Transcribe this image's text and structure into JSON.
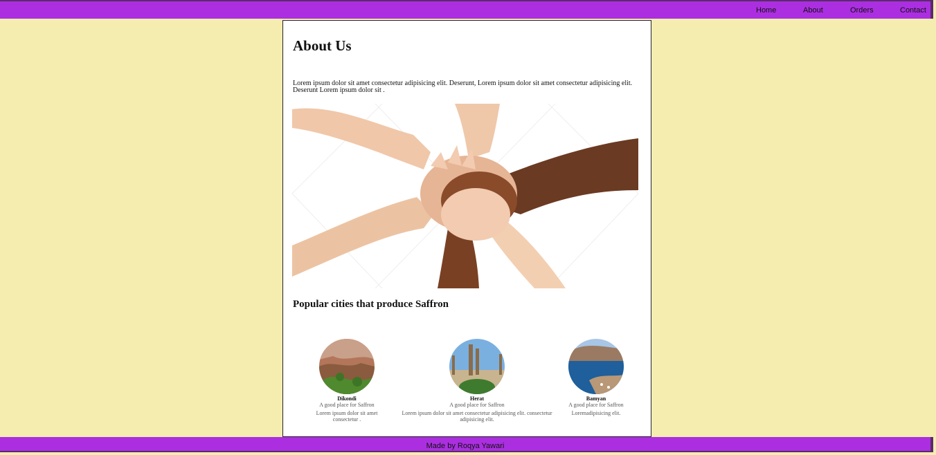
{
  "nav": {
    "home": "Home",
    "about": "About",
    "orders": "Orders",
    "contact": "Contact"
  },
  "main": {
    "title": "About Us",
    "intro": "Lorem ipsum dolor sit amet consectetur adipisicing elit. Deserunt, Lorem ipsum dolor sit amet consectetur adipisicing elit. Deserunt Lorem ipsum dolor sit .",
    "hero_image": "stacked-hands-teamwork-photo",
    "subtitle": "Popular cities that produce Saffron",
    "cities": [
      {
        "name": "Dikondi",
        "tag": "A good place for Saffron",
        "desc": "Lorem ipsum dolor sit amet consectetur .",
        "image": "rocky-valley-village-photo"
      },
      {
        "name": "Herat",
        "tag": "A good place for Saffron",
        "desc": "Lorem ipsum dolor sit amet consectetur adipisicing elit. consectetur adipisicing elit.",
        "image": "minarets-photo"
      },
      {
        "name": "Bamyan",
        "tag": "A good place for Saffron",
        "desc": "Loremadipisicing elit.",
        "image": "blue-lake-cliffs-photo"
      }
    ]
  },
  "footer": {
    "text": "Made by Roqya Yawari"
  },
  "colors": {
    "background": "#f5ecb0",
    "bar": "#ab2fe0",
    "card": "#ffffff"
  }
}
